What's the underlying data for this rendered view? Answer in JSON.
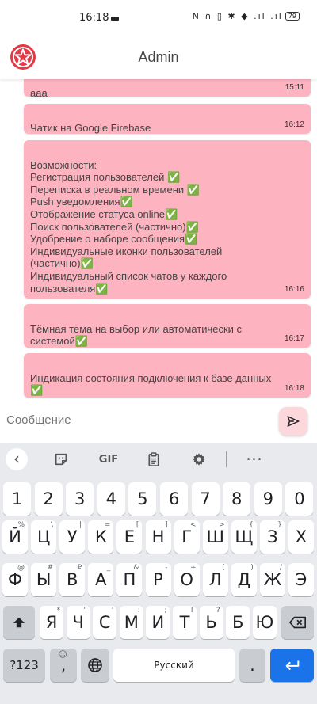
{
  "status": {
    "time": "16:18",
    "icons": "N ∩ ▯ ✱ ◆ .ıl .ıl",
    "battery": "79"
  },
  "app": {
    "title": "Admin"
  },
  "messages": [
    {
      "text": "aaa",
      "time": "15:11"
    },
    {
      "text": "Чатик на Google Firebase",
      "time": "16:12"
    },
    {
      "text": "Возможности:\nРегистрация пользователей ✅\nПереписка в реальном времени ✅\nPush уведомления✅\nОтображение статуса online✅\nПоиск пользователей (частично)✅\nУдобрение о наборе сообщения✅\nИндивидуальные иконки пользователей\n(частично)✅\nИндивидуальный список чатов у каждого\nпользователя✅",
      "time": "16:16"
    },
    {
      "text": "Тёмная тема на выбор или автоматически с\nсистемой✅",
      "time": "16:17"
    },
    {
      "text": "Индикация состояния подключения к базе данных\n✅",
      "time": "16:18"
    }
  ],
  "input": {
    "placeholder": "Сообщение"
  },
  "keyboard": {
    "toolbar": {
      "back": "‹",
      "gif": "GIF",
      "more": "•••"
    },
    "numbers": [
      "1",
      "2",
      "3",
      "4",
      "5",
      "6",
      "7",
      "8",
      "9",
      "0"
    ],
    "row1": [
      {
        "k": "Й",
        "h": "%"
      },
      {
        "k": "Ц",
        "h": "\\"
      },
      {
        "k": "У",
        "h": "|"
      },
      {
        "k": "К",
        "h": "="
      },
      {
        "k": "Е",
        "h": "["
      },
      {
        "k": "Н",
        "h": "]"
      },
      {
        "k": "Г",
        "h": "<"
      },
      {
        "k": "Ш",
        "h": ">"
      },
      {
        "k": "Щ",
        "h": "{"
      },
      {
        "k": "З",
        "h": "}"
      },
      {
        "k": "Х",
        "h": ""
      }
    ],
    "row2": [
      {
        "k": "Ф",
        "h": "@"
      },
      {
        "k": "Ы",
        "h": "#"
      },
      {
        "k": "В",
        "h": "₽"
      },
      {
        "k": "А",
        "h": "_"
      },
      {
        "k": "П",
        "h": "&"
      },
      {
        "k": "Р",
        "h": "-"
      },
      {
        "k": "О",
        "h": "+"
      },
      {
        "k": "Л",
        "h": "("
      },
      {
        "k": "Д",
        "h": ")"
      },
      {
        "k": "Ж",
        "h": "/"
      },
      {
        "k": "Э",
        "h": ""
      }
    ],
    "row3": [
      {
        "k": "Я",
        "h": "*"
      },
      {
        "k": "Ч",
        "h": "\""
      },
      {
        "k": "С",
        "h": "'"
      },
      {
        "k": "М",
        "h": ":"
      },
      {
        "k": "И",
        "h": ";"
      },
      {
        "k": "Т",
        "h": "!"
      },
      {
        "k": "Ь",
        "h": "?"
      },
      {
        "k": "Б",
        "h": ""
      },
      {
        "k": "Ю",
        "h": ""
      }
    ],
    "symbols_label": "?123",
    "comma": ",",
    "space_label": "Русский",
    "period": "."
  },
  "colors": {
    "bubble": "#fdb3c0",
    "send_button": "#fcd7dc",
    "enter_key": "#1a73e8",
    "logo": "#e53945"
  },
  "icons": [
    "star-logo-icon",
    "send-icon",
    "chevron-left-icon",
    "sticker-icon",
    "clipboard-icon",
    "gear-icon",
    "shift-icon",
    "backspace-icon",
    "emoji-icon",
    "globe-icon",
    "enter-icon"
  ]
}
